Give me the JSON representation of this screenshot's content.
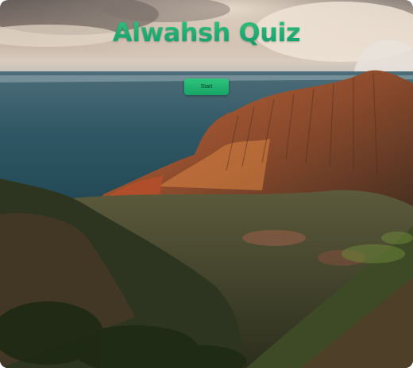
{
  "quiz": {
    "title": "Alwahsh Quiz",
    "start_label": "Start"
  },
  "colors": {
    "title": "#1fa86f",
    "button": "#22b572",
    "button_text": "#0d3b25"
  },
  "background": {
    "description_icon": "mountain-landscape-image"
  }
}
